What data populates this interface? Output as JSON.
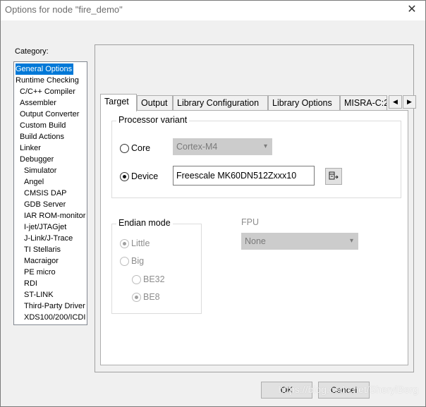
{
  "window": {
    "title": "Options for node \"fire_demo\"",
    "close_glyph": "✕"
  },
  "category": {
    "label": "Category:",
    "items": [
      {
        "label": "General Options",
        "level": 0,
        "selected": true
      },
      {
        "label": "Runtime Checking",
        "level": 0
      },
      {
        "label": "C/C++ Compiler",
        "level": 1
      },
      {
        "label": "Assembler",
        "level": 1
      },
      {
        "label": "Output Converter",
        "level": 1
      },
      {
        "label": "Custom Build",
        "level": 1
      },
      {
        "label": "Build Actions",
        "level": 1
      },
      {
        "label": "Linker",
        "level": 1
      },
      {
        "label": "Debugger",
        "level": 1
      },
      {
        "label": "Simulator",
        "level": 2
      },
      {
        "label": "Angel",
        "level": 2
      },
      {
        "label": "CMSIS DAP",
        "level": 2
      },
      {
        "label": "GDB Server",
        "level": 2
      },
      {
        "label": "IAR ROM-monitor",
        "level": 2
      },
      {
        "label": "I-jet/JTAGjet",
        "level": 2
      },
      {
        "label": "J-Link/J-Trace",
        "level": 2
      },
      {
        "label": "TI Stellaris",
        "level": 2
      },
      {
        "label": "Macraigor",
        "level": 2
      },
      {
        "label": "PE micro",
        "level": 2
      },
      {
        "label": "RDI",
        "level": 2
      },
      {
        "label": "ST-LINK",
        "level": 2
      },
      {
        "label": "Third-Party Driver",
        "level": 2
      },
      {
        "label": "XDS100/200/ICDI",
        "level": 2
      }
    ]
  },
  "tabs": {
    "items": [
      {
        "label": "Target",
        "active": true
      },
      {
        "label": "Output"
      },
      {
        "label": "Library Configuration"
      },
      {
        "label": "Library Options"
      },
      {
        "label": "MISRA-C:2"
      }
    ],
    "scroll_left": "◀",
    "scroll_right": "▶"
  },
  "processor": {
    "group_title": "Processor variant",
    "core_label": "Core",
    "core_value": "Cortex-M4",
    "device_label": "Device",
    "device_value": "Freescale MK60DN512Zxxx10",
    "selected": "Device"
  },
  "endian": {
    "group_title": "Endian mode",
    "little_label": "Little",
    "big_label": "Big",
    "be32_label": "BE32",
    "be8_label": "BE8"
  },
  "fpu": {
    "label": "FPU",
    "value": "None"
  },
  "buttons": {
    "ok": "OK",
    "cancel": "Cancel"
  },
  "watermark": "https://blog.csdn.net/SherylBerg",
  "icons": {
    "dropdown": "▾",
    "browse": "browse-device-icon"
  },
  "colors": {
    "selection": "#0078d7",
    "disabled_text": "#8d8d8d"
  }
}
